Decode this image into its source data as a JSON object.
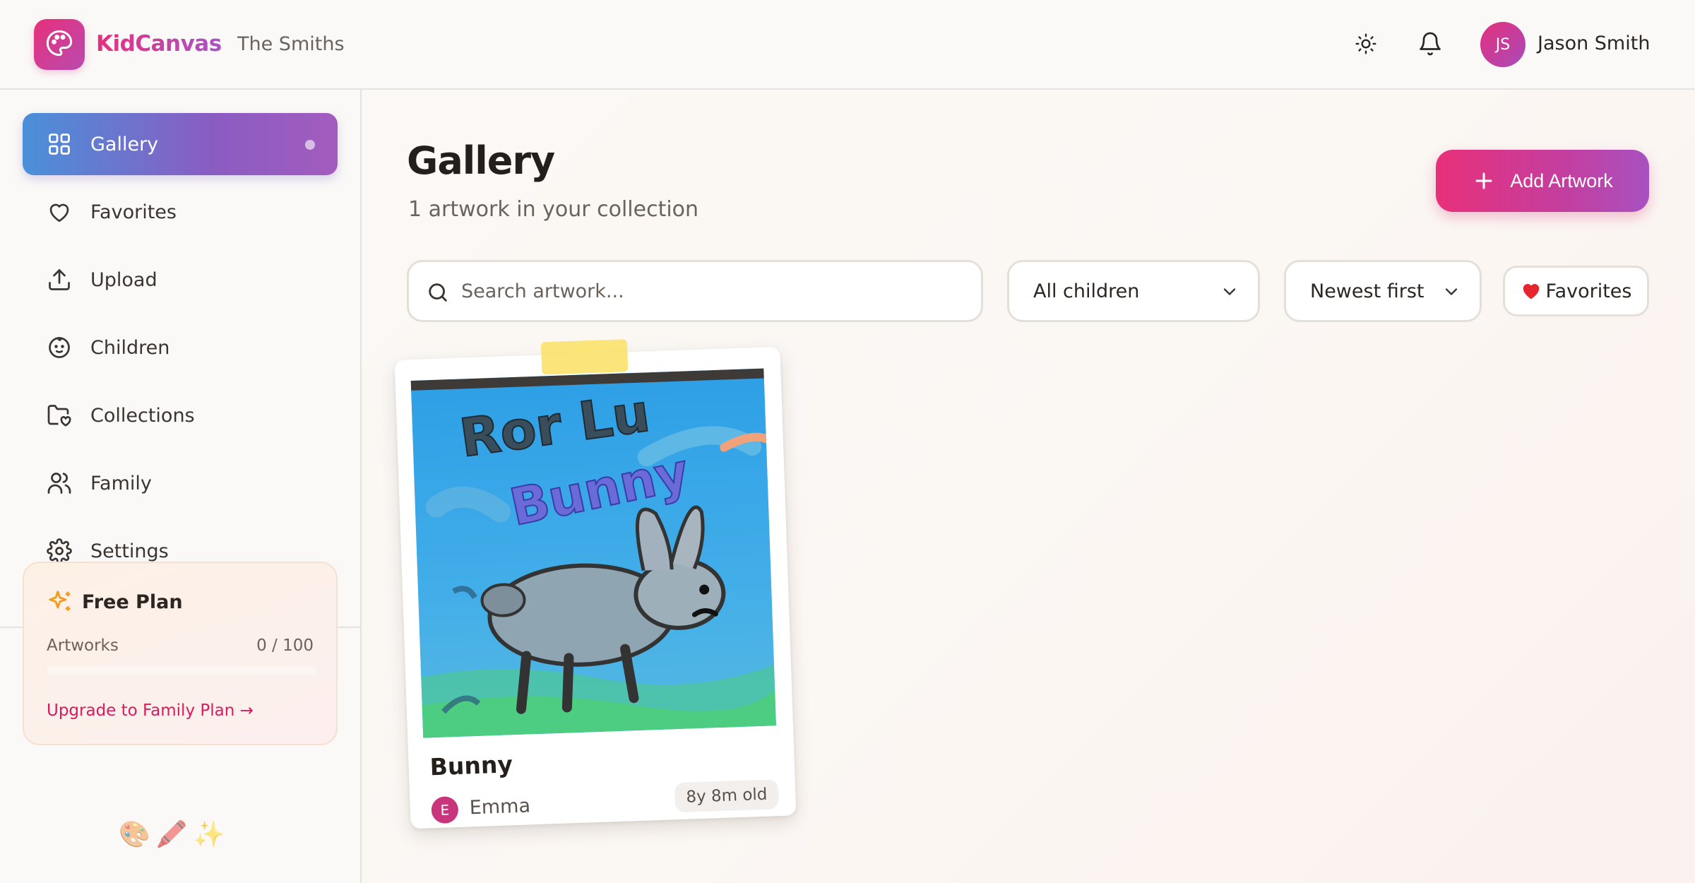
{
  "header": {
    "brand": "KidCanvas",
    "family_name": "The Smiths",
    "user": {
      "initials": "JS",
      "name": "Jason Smith"
    },
    "icons": [
      "palette-icon",
      "sun-icon",
      "bell-icon"
    ]
  },
  "sidebar": {
    "items": [
      {
        "label": "Gallery",
        "icon": "grid-icon",
        "active": true
      },
      {
        "label": "Favorites",
        "icon": "heart-icon",
        "active": false
      },
      {
        "label": "Upload",
        "icon": "upload-icon",
        "active": false
      },
      {
        "label": "Children",
        "icon": "child-face-icon",
        "active": false
      },
      {
        "label": "Collections",
        "icon": "folder-heart-icon",
        "active": false
      },
      {
        "label": "Family",
        "icon": "users-icon",
        "active": false
      },
      {
        "label": "Settings",
        "icon": "gear-icon",
        "active": false
      }
    ],
    "plan": {
      "title": "Free Plan",
      "metric_label": "Artworks",
      "metric_value": "0 / 100",
      "progress_fraction": 0.0,
      "upgrade_link": "Upgrade to Family Plan →"
    },
    "decor_emoji": "🎨🖍️✨"
  },
  "main": {
    "title": "Gallery",
    "subtitle": "1 artwork in your collection",
    "add_button": "Add Artwork",
    "search": {
      "placeholder": "Search artwork...",
      "value": ""
    },
    "child_filter": {
      "selected": "All children"
    },
    "sort": {
      "selected": "Newest first"
    },
    "favorites_button": "Favorites"
  },
  "artworks": [
    {
      "title": "Bunny",
      "child_initial": "E",
      "child_name": "Emma",
      "age": "8y 8m old",
      "painted_text": [
        "Ror Lu",
        "Bunny"
      ]
    }
  ],
  "colors": {
    "accent_pink": "#e5307c",
    "accent_purple": "#a855c6",
    "accent_blue": "#4a90d9",
    "link": "#d81b60"
  }
}
